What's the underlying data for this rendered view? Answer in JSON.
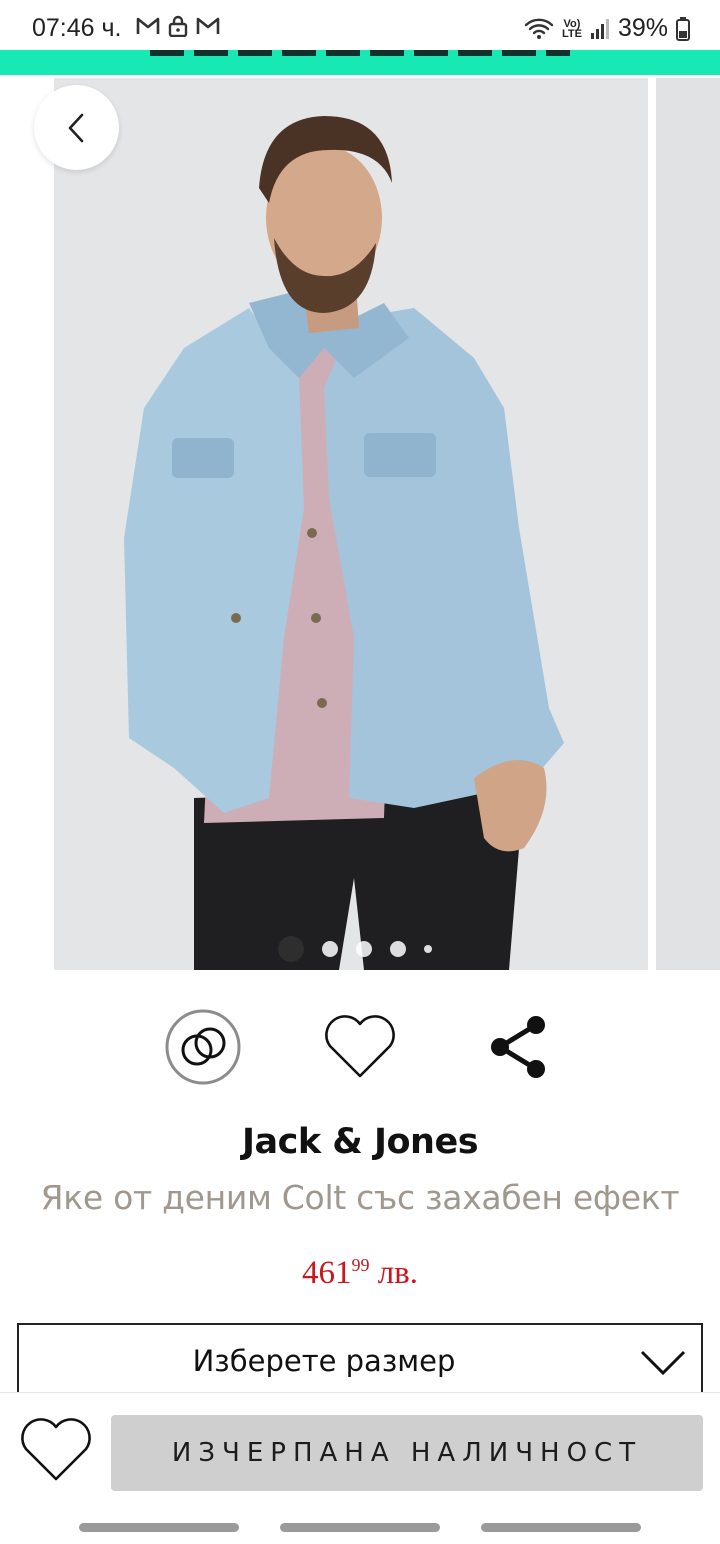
{
  "status_bar": {
    "time": "07:46 ч.",
    "battery": "39%",
    "lte_label": "Vo) LTE",
    "left_icons": [
      "gmail-icon",
      "lock-icon",
      "gmail-icon"
    ],
    "right_icons": [
      "wifi-icon",
      "lte-icon",
      "signal-icon",
      "battery-icon"
    ]
  },
  "gallery": {
    "back_icon": "chevron-left-icon",
    "dots_count": 5,
    "active_dot": 0
  },
  "actions": {
    "compare_icon": "compare-rings-icon",
    "favorite_icon": "heart-icon",
    "share_icon": "share-icon"
  },
  "product": {
    "brand": "Jack & Jones",
    "title": "Яке от деним Colt със захабен ефект",
    "price_main": "461",
    "price_cents": "99",
    "price_currency": "лв.",
    "price_color": "#c8171e"
  },
  "size_select": {
    "label": "Изберете размер"
  },
  "bottom_bar": {
    "wishlist_icon": "heart-icon",
    "button_label": "ИЗЧЕРПАНА НАЛИЧНОСТ"
  },
  "colors": {
    "accent": "#17e8b4",
    "disabled_button": "#cfcfcf"
  }
}
